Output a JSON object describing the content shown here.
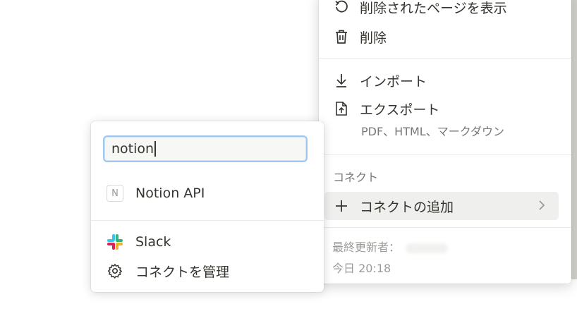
{
  "menu": {
    "items_top": [
      {
        "label": "削除されたページを表示",
        "icon": "restore-icon"
      },
      {
        "label": "削除",
        "icon": "trash-icon"
      }
    ],
    "import_label": "インポート",
    "export_label": "エクスポート",
    "export_sub": "PDF、HTML、マークダウン",
    "connect_section": "コネクト",
    "add_connection_label": "コネクトの追加",
    "last_edited_label": "最終更新者：",
    "last_edited_time": "今日 20:18"
  },
  "popup": {
    "search_value": "notion",
    "result_label": "Notion API",
    "result_badge": "N",
    "slack_label": "Slack",
    "manage_label": "コネクトを管理"
  },
  "colors": {
    "accent": "#9ec8ef",
    "text": "#37352f",
    "muted": "#787774",
    "hover_bg": "#efefee"
  }
}
